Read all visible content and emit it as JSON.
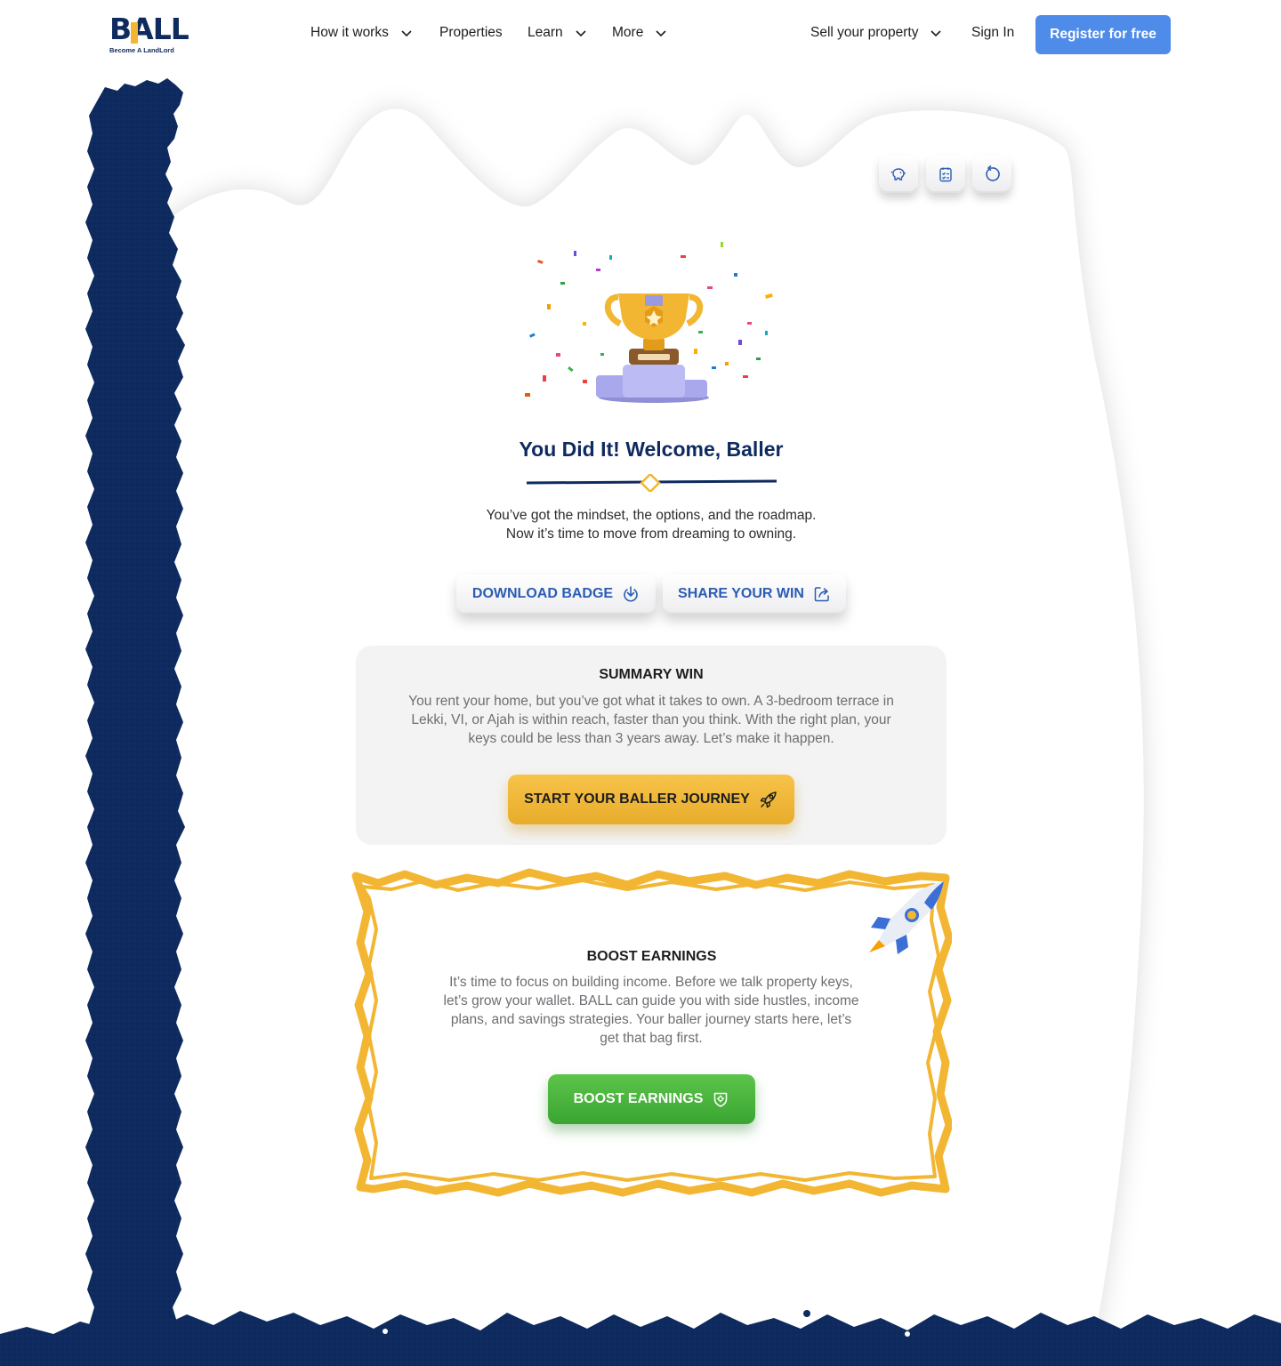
{
  "brand": {
    "logo_text": "BALL",
    "tagline": "Become A LandLord",
    "navy": "#0e2a5e",
    "gold": "#f2b632",
    "blue": "#4f8be8"
  },
  "nav": {
    "items": [
      {
        "label": "How it works",
        "has_dropdown": true
      },
      {
        "label": "Properties",
        "has_dropdown": false
      },
      {
        "label": "Learn",
        "has_dropdown": true
      },
      {
        "label": "More",
        "has_dropdown": true
      }
    ],
    "sell": {
      "label": "Sell your property",
      "has_dropdown": true
    },
    "sign_in": "Sign In",
    "register": "Register for free"
  },
  "toolbar": {
    "icons": [
      "piggy-bank-icon",
      "checklist-icon",
      "refresh-icon"
    ]
  },
  "hero": {
    "image": "trophy-confetti-illustration",
    "title": "You Did It! Welcome, Baller",
    "subtitle_lines": [
      "You’ve got the mindset, the options, and the roadmap.",
      "Now it’s time to move from dreaming to owning."
    ],
    "download_label": "DOWNLOAD BADGE",
    "share_label": "SHARE YOUR WIN"
  },
  "summary": {
    "heading": "SUMMARY WIN",
    "lines": [
      "You rent your home, but you’ve got what it takes to own. A 3-bedroom terrace in",
      "Lekki, VI, or Ajah is within reach, faster than you think. With the right plan, your",
      "keys could be less than 3 years away. Let’s make it happen."
    ],
    "cta": "START YOUR BALLER JOURNEY"
  },
  "boost": {
    "heading": "BOOST EARNINGS",
    "lines": [
      "It’s time to focus on building income. Before we talk property keys,",
      "let’s grow your wallet. BALL can guide you with side hustles, income",
      "plans, and savings strategies. Your baller journey starts here, let’s",
      "get that bag first."
    ],
    "cta": "BOOST EARNINGS"
  }
}
